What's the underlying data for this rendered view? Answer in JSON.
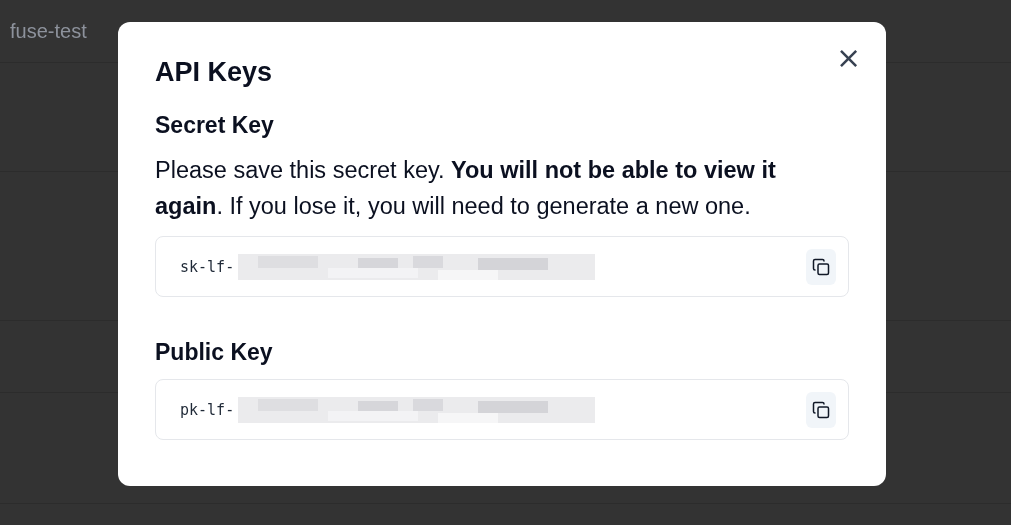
{
  "background_page": {
    "project_name": "fuse-test"
  },
  "dialog": {
    "title": "API Keys",
    "close_label": "×",
    "sections": [
      {
        "heading": "Secret Key",
        "description": "Please save this secret key. **You will not be able to view it again**. If you lose it, you will need to generate a new one.",
        "key_visible": "sk-lf-"
      },
      {
        "heading": "Public Key",
        "key_visible": "pk-lf-"
      }
    ]
  }
}
